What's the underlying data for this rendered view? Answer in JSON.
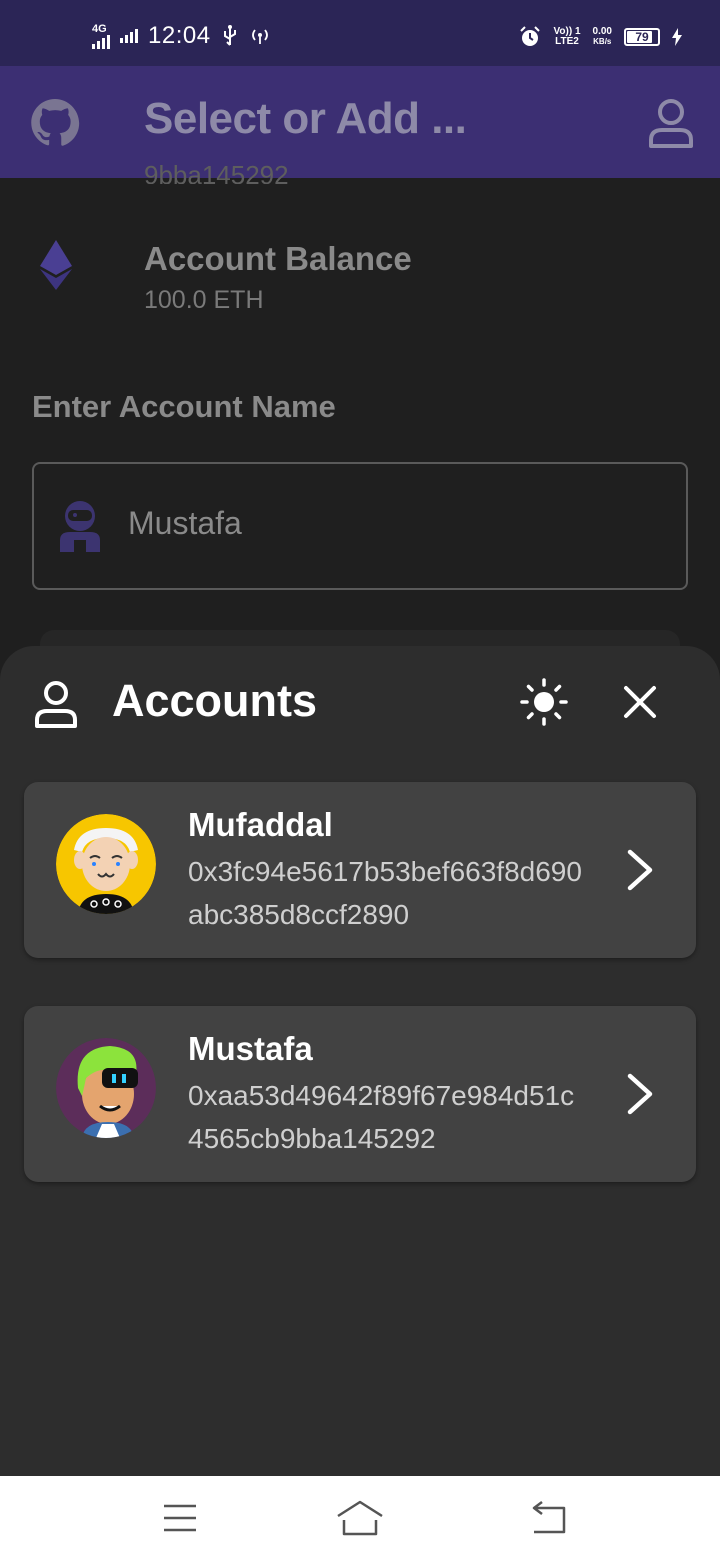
{
  "status_bar": {
    "network": "4G",
    "time": "12:04",
    "volte": "Vo)) 1",
    "lte": "LTE2",
    "speed": "0.00",
    "speed_unit": "KB/s",
    "battery": "79"
  },
  "app_bar": {
    "title": "Select or Add ...",
    "icons": [
      "github-icon",
      "user-icon"
    ]
  },
  "background": {
    "partial_address": "9bba145292",
    "balance_title": "Account Balance",
    "balance_value": "100.0 ETH",
    "name_label": "Enter Account Name",
    "name_value": "Mustafa"
  },
  "sheet": {
    "title": "Accounts",
    "accounts": [
      {
        "name": "Mufaddal",
        "address": "0x3fc94e5617b53bef663f8d690abc385d8ccf2890"
      },
      {
        "name": "Mustafa",
        "address": "0xaa53d49642f89f67e984d51c4565cb9bba145292"
      }
    ]
  },
  "colors": {
    "status_bar": "#2b2556",
    "app_bar": "#3c2f73",
    "sheet": "#2d2d2d",
    "card": "#424242",
    "eth": "#4a3f93"
  },
  "nav": {
    "icons": [
      "menu-icon",
      "home-icon",
      "back-icon"
    ]
  }
}
